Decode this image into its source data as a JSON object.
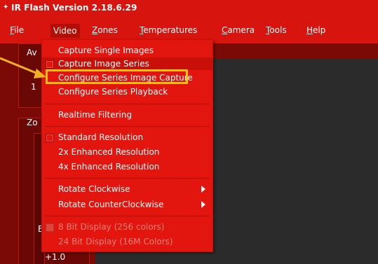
{
  "window": {
    "title": "IR Flash Version 2.18.6.29"
  },
  "menubar": [
    {
      "label": "File",
      "underline": "F",
      "rest": "ile"
    },
    {
      "label": "Video",
      "underline": "",
      "rest": "Video"
    },
    {
      "label": "Zones",
      "underline": "Z",
      "rest": "ones"
    },
    {
      "label": "Temperatures",
      "underline": "T",
      "rest": "emperatures"
    },
    {
      "label": "Camera",
      "underline": "C",
      "rest": "amera"
    },
    {
      "label": "Tools",
      "underline": "T",
      "rest": "ools"
    },
    {
      "label": "Help",
      "underline": "H",
      "rest": "elp"
    }
  ],
  "left_panel": {
    "avg_label": "Av",
    "avg_value": "1",
    "zoom_label": "Zo",
    "bottom_label": "E",
    "bottom_value": "+1.0"
  },
  "video_menu": {
    "items": [
      {
        "label": "Capture Single Images"
      },
      {
        "label": "Capture Image Series"
      },
      {
        "label": "Configure Series Image Capture"
      },
      {
        "label": "Configure Series Playback"
      },
      {
        "label": "Realtime Filtering"
      },
      {
        "label": "Standard Resolution"
      },
      {
        "label": "2x Enhanced Resolution"
      },
      {
        "label": "4x Enhanced Resolution"
      },
      {
        "label": "Rotate Clockwise"
      },
      {
        "label": "Rotate CounterClockwise"
      },
      {
        "label": "8 Bit Display (256 colors)"
      },
      {
        "label": "24 Bit Display (16M Colors)"
      }
    ]
  },
  "colors": {
    "menu_red": "#e3150f",
    "highlight_yellow": "#f6c400",
    "annotation_arrow": "#f2b21e"
  }
}
